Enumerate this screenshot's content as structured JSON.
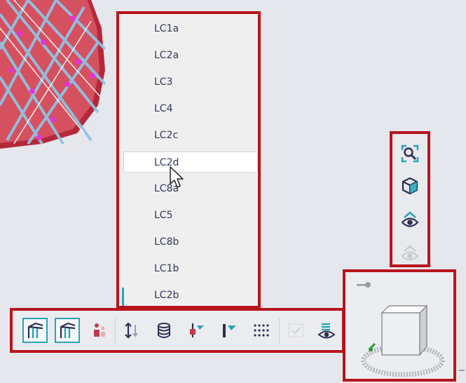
{
  "load_case_dropdown": {
    "items": [
      "LC1a",
      "LC2a",
      "LC3",
      "LC4",
      "LC2c",
      "LC2d",
      "LC8a",
      "LC5",
      "LC8b",
      "LC1b",
      "LC2b"
    ],
    "hovered": "LC2d"
  },
  "side_toolbar": {
    "buttons": [
      "zoom-fit-icon",
      "3d-view-cube-icon",
      "show-hide-eye-icon",
      "eye-disabled-icon"
    ]
  },
  "bottom_toolbar": {
    "buttons": [
      "structure-frame-icon",
      "structure-frame-alt-icon",
      "person-load-icon",
      "vertical-arrows-icon",
      "database-icon",
      "support-node-icon",
      "member-section-icon",
      "grid-points-icon",
      "check-results-icon",
      "layers-eye-icon"
    ]
  },
  "view_cube": {
    "pin": "pin-icon"
  },
  "colors": {
    "highlight_border": "#b7151c",
    "accent": "#27a3b8",
    "text": "#34385e"
  }
}
